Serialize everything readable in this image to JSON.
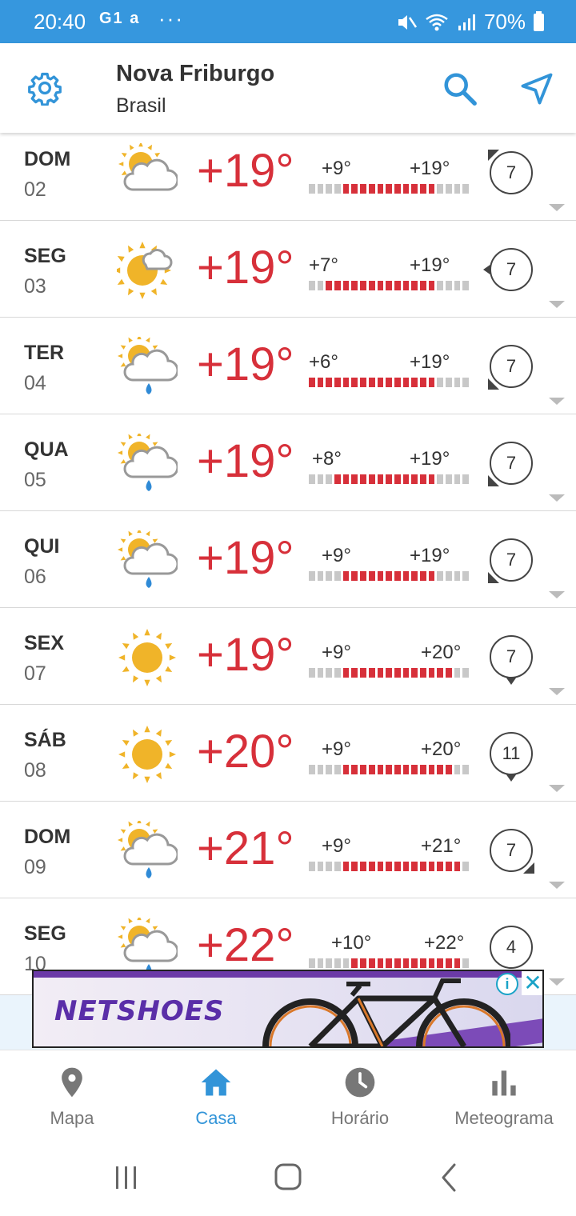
{
  "status_bar": {
    "time": "20:40",
    "left_icons": "G1 a",
    "dots": "···",
    "battery": "70%"
  },
  "header": {
    "city": "Nova Friburgo",
    "country": "Brasil",
    "accent_color": "#3294d8"
  },
  "days": [
    {
      "name": "DOM",
      "date": "02",
      "icon": "partly-cloudy-icon",
      "temp": "+19°",
      "min": "+9°",
      "max": "+19°",
      "min_fill": 0.2,
      "max_fill": 0.83,
      "wind": "7",
      "wind_dir": "top-left"
    },
    {
      "name": "SEG",
      "date": "03",
      "icon": "sun-cloud-icon",
      "temp": "+19°",
      "min": "+7°",
      "max": "+19°",
      "min_fill": 0.1,
      "max_fill": 0.83,
      "wind": "7",
      "wind_dir": "left"
    },
    {
      "name": "TER",
      "date": "04",
      "icon": "sun-rain-icon",
      "temp": "+19°",
      "min": "+6°",
      "max": "+19°",
      "min_fill": 0.0,
      "max_fill": 0.83,
      "wind": "7",
      "wind_dir": "bottom-left"
    },
    {
      "name": "QUA",
      "date": "05",
      "icon": "sun-rain-icon",
      "temp": "+19°",
      "min": "+8°",
      "max": "+19°",
      "min_fill": 0.13,
      "max_fill": 0.83,
      "wind": "7",
      "wind_dir": "bottom-left"
    },
    {
      "name": "QUI",
      "date": "06",
      "icon": "sun-rain-icon",
      "temp": "+19°",
      "min": "+9°",
      "max": "+19°",
      "min_fill": 0.2,
      "max_fill": 0.83,
      "wind": "7",
      "wind_dir": "bottom-left"
    },
    {
      "name": "SEX",
      "date": "07",
      "icon": "sun-icon",
      "temp": "+19°",
      "min": "+9°",
      "max": "+20°",
      "min_fill": 0.2,
      "max_fill": 0.9,
      "wind": "7",
      "wind_dir": "bottom"
    },
    {
      "name": "SÁB",
      "date": "08",
      "icon": "sun-icon",
      "temp": "+20°",
      "min": "+9°",
      "max": "+20°",
      "min_fill": 0.2,
      "max_fill": 0.9,
      "wind": "11",
      "wind_dir": "bottom"
    },
    {
      "name": "DOM",
      "date": "09",
      "icon": "sun-rain-icon",
      "temp": "+21°",
      "min": "+9°",
      "max": "+21°",
      "min_fill": 0.2,
      "max_fill": 0.97,
      "wind": "7",
      "wind_dir": "bottom-right"
    },
    {
      "name": "SEG",
      "date": "10",
      "icon": "sun-rain-icon",
      "temp": "+22°",
      "min": "+10°",
      "max": "+22°",
      "min_fill": 0.27,
      "max_fill": 0.97,
      "wind": "4",
      "wind_dir": "none"
    }
  ],
  "ad": {
    "brand": "NETSHOES",
    "info_symbol": "i",
    "close_symbol": "✕"
  },
  "bottom_nav": [
    {
      "label": "Mapa",
      "icon": "map-pin-icon",
      "active": false
    },
    {
      "label": "Casa",
      "icon": "home-icon",
      "active": true
    },
    {
      "label": "Horário",
      "icon": "clock-icon",
      "active": false
    },
    {
      "label": "Meteograma",
      "icon": "bar-chart-icon",
      "active": false
    }
  ],
  "colors": {
    "temp_red": "#d7303a",
    "status_blue": "#3697de",
    "sun_yellow": "#f0b429"
  }
}
